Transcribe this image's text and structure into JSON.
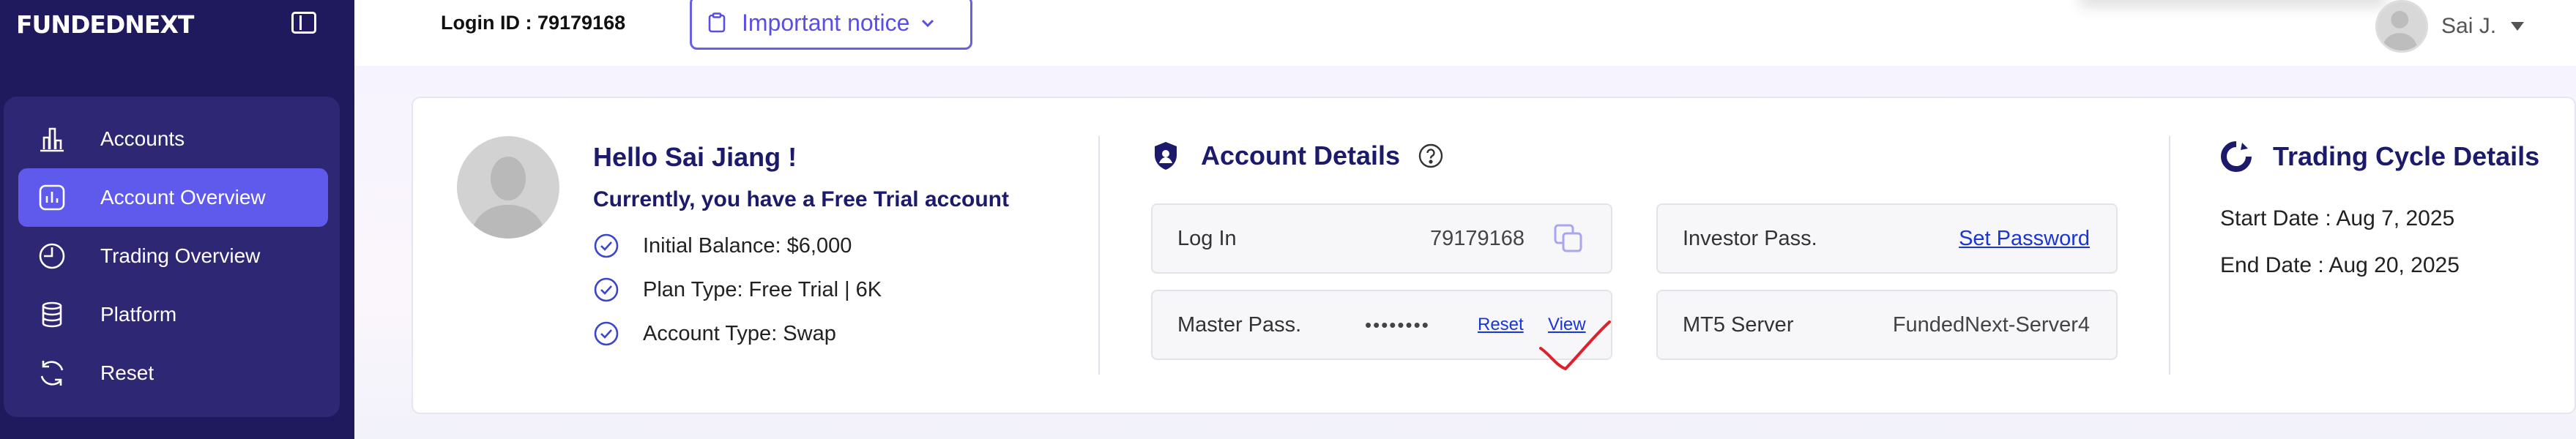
{
  "sidebar": {
    "logo": "FUNDEDNEXT",
    "items": [
      {
        "label": "Accounts",
        "icon": "bar-chart-icon"
      },
      {
        "label": "Account Overview",
        "icon": "overview-icon",
        "active": true
      },
      {
        "label": "Trading Overview",
        "icon": "clock-pie-icon"
      },
      {
        "label": "Platform",
        "icon": "database-icon"
      },
      {
        "label": "Reset",
        "icon": "refresh-icon"
      }
    ]
  },
  "header": {
    "login_id": "Login ID : 79179168",
    "notice_label": "Important notice",
    "user_name": "Sai J."
  },
  "profile": {
    "greeting": "Hello Sai Jiang !",
    "subtitle": "Currently, you have a Free Trial account",
    "details": [
      "Initial Balance: $6,000",
      "Plan Type: Free Trial | 6K",
      "Account Type: Swap"
    ]
  },
  "account_details": {
    "title": "Account Details",
    "login_label": "Log In",
    "login_value": "79179168",
    "master_label": "Master Pass.",
    "master_value": "••••••••",
    "reset_link": "Reset",
    "view_link": "View",
    "investor_label": "Investor Pass.",
    "set_password_link": "Set Password",
    "server_label": "MT5 Server",
    "server_value": "FundedNext-Server4"
  },
  "trading_cycle": {
    "title": "Trading Cycle Details",
    "start": "Start Date : Aug 7, 2025",
    "end": "End Date : Aug 20, 2025"
  },
  "colors": {
    "sidebar_bg": "#1f1a5e",
    "nav_bg": "#2d2774",
    "accent": "#5f5aec",
    "heading": "#1c1a6b",
    "link": "#1a35d6",
    "annotation": "#e0202a"
  }
}
